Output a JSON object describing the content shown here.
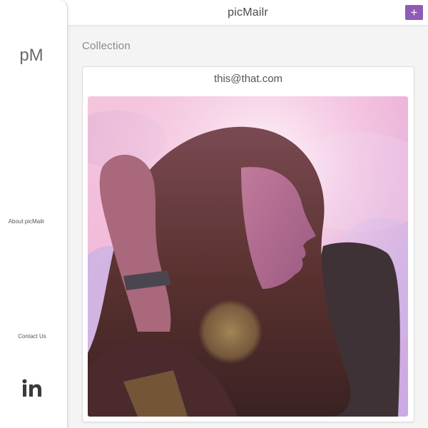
{
  "header": {
    "app_title": "picMailr",
    "add_button_label": "+",
    "add_button_color": "#8e5bb6"
  },
  "sidebar": {
    "logo": "pM",
    "links": {
      "about": "About picMailr",
      "contact": "Contact Us"
    },
    "social_icon": "linkedin-icon",
    "social_icon_text": "in"
  },
  "main": {
    "section_title": "Collection",
    "cards": [
      {
        "email": "this@that.com",
        "image": "portrait-photo"
      }
    ]
  }
}
